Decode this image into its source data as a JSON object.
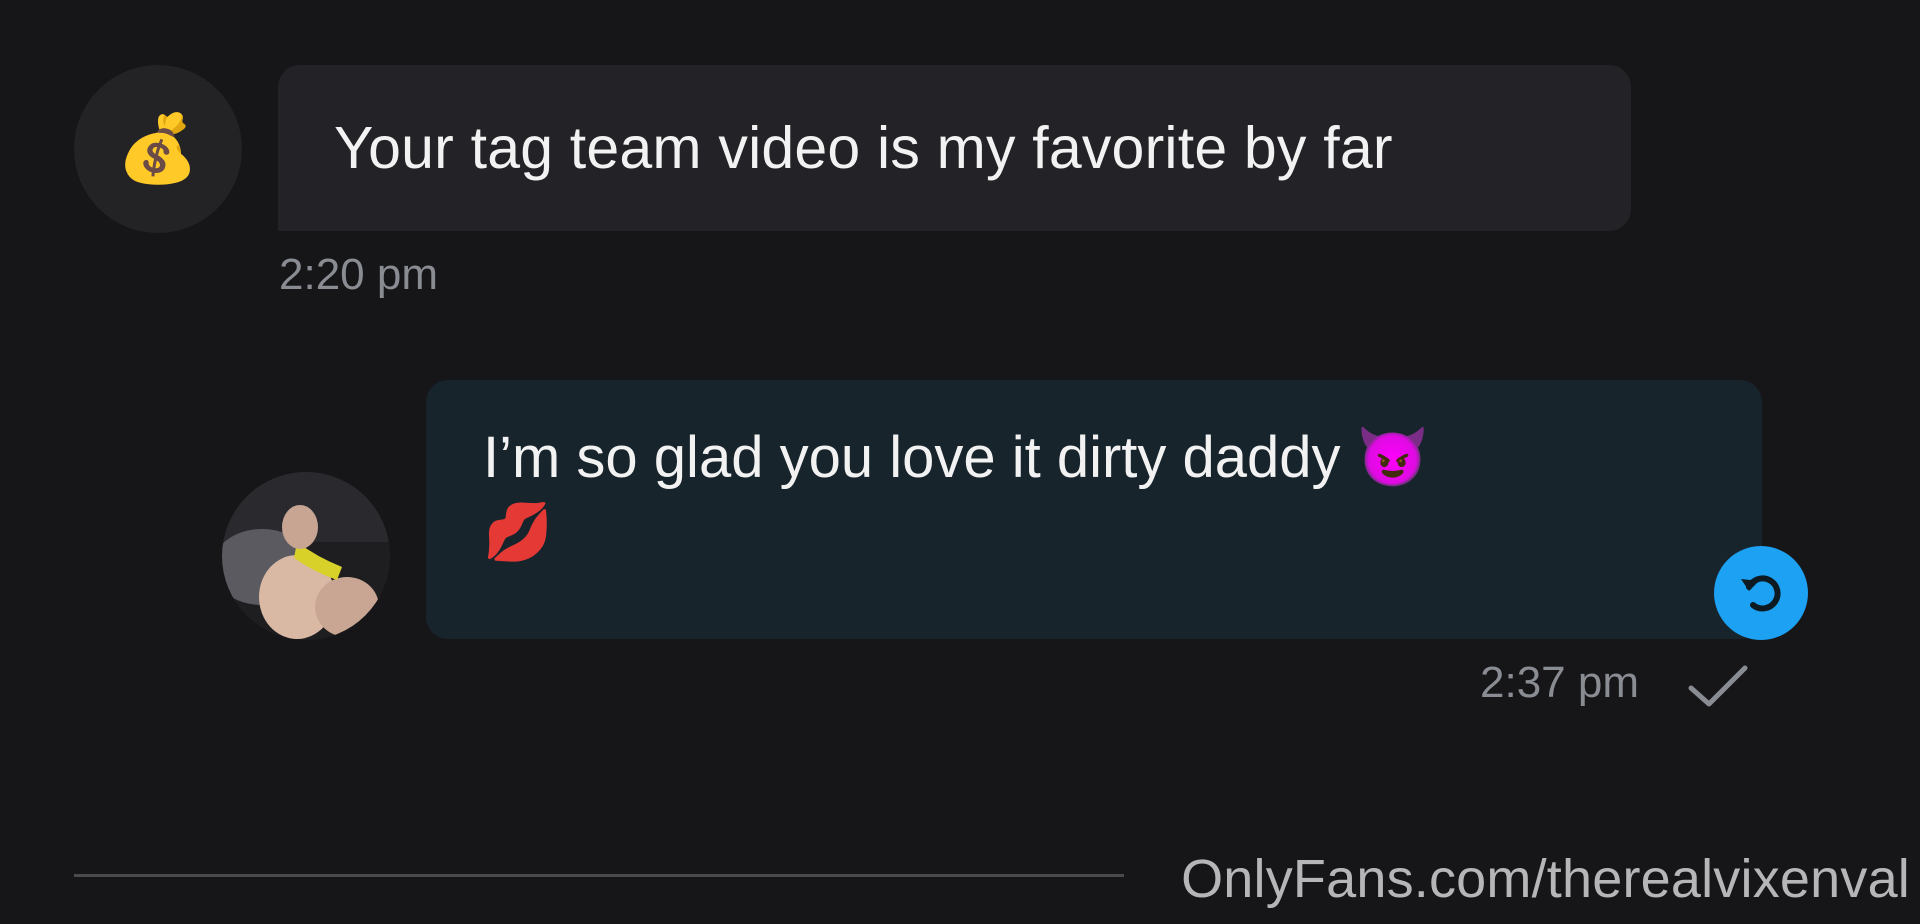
{
  "messages": [
    {
      "direction": "incoming",
      "avatar_emoji": "💰",
      "text": "Your tag team video is my favorite by far",
      "time": "2:20 pm"
    },
    {
      "direction": "outgoing",
      "text": "I’m so glad you love it dirty daddy 😈",
      "text_line2": "💋",
      "time": "2:37 pm",
      "status_icon": "checkmark-icon",
      "action_icon": "reply-icon"
    }
  ],
  "watermark": "OnlyFans.com/therealvixenval",
  "colors": {
    "background": "#161618",
    "incoming_bubble": "#232327",
    "outgoing_bubble": "#17242c",
    "accent": "#1da1f2",
    "timestamp": "#8a8c93"
  }
}
